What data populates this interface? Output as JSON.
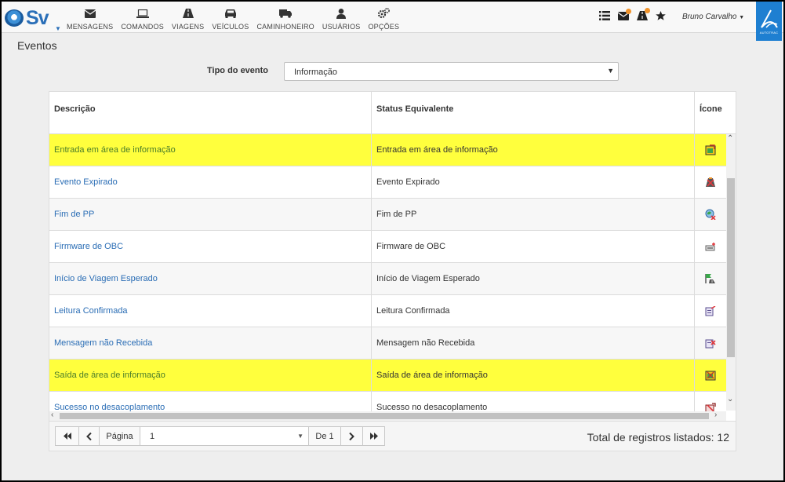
{
  "app": {
    "logo_text": "Sv",
    "nav": [
      {
        "label": "MENSAGENS",
        "icon": "envelope-icon"
      },
      {
        "label": "COMANDOS",
        "icon": "laptop-icon"
      },
      {
        "label": "VIAGENS",
        "icon": "road-icon"
      },
      {
        "label": "VEÍCULOS",
        "icon": "car-icon"
      },
      {
        "label": "CAMINHONEIRO",
        "icon": "truck-icon"
      },
      {
        "label": "USUÁRIOS",
        "icon": "user-icon"
      },
      {
        "label": "OPÇÕES",
        "icon": "gears-icon"
      }
    ],
    "user_name": "Bruno Carvalho",
    "brand_text": "AUTOTRAC"
  },
  "page": {
    "title": "Eventos",
    "filter_label": "Tipo do evento",
    "filter_value": "Informação"
  },
  "table": {
    "headers": [
      "Descrição",
      "Status Equivalente",
      "Ícone"
    ],
    "rows": [
      {
        "descricao": "Entrada em área de informação",
        "status": "Entrada em área de informação",
        "highlight": true,
        "icon": "area-enter-icon"
      },
      {
        "descricao": "Evento Expirado",
        "status": "Evento Expirado",
        "highlight": false,
        "icon": "expired-road-icon"
      },
      {
        "descricao": "Fim de PP",
        "status": "Fim de PP",
        "highlight": false,
        "icon": "globe-x-icon"
      },
      {
        "descricao": "Firmware de OBC",
        "status": "Firmware de OBC",
        "highlight": false,
        "icon": "firmware-icon"
      },
      {
        "descricao": "Início de Viagem Esperado",
        "status": "Início de Viagem Esperado",
        "highlight": false,
        "icon": "trip-start-icon"
      },
      {
        "descricao": "Leitura Confirmada",
        "status": "Leitura Confirmada",
        "highlight": false,
        "icon": "read-confirmed-icon"
      },
      {
        "descricao": "Mensagem não Recebida",
        "status": "Mensagem não Recebida",
        "highlight": false,
        "icon": "message-x-icon"
      },
      {
        "descricao": "Saída de área de informação",
        "status": "Saída de área de informação",
        "highlight": true,
        "icon": "area-exit-icon"
      },
      {
        "descricao": "Sucesso no desacoplamento",
        "status": "Sucesso no desacoplamento",
        "highlight": false,
        "icon": "uncoupling-icon"
      }
    ]
  },
  "pager": {
    "page_label": "Página",
    "page_value": "1",
    "of_label": "De 1",
    "total_text": "Total de registros listados: 12"
  },
  "colors": {
    "highlight": "#ffff3d",
    "link": "#2a6db5",
    "brand": "#1e7fd1"
  }
}
